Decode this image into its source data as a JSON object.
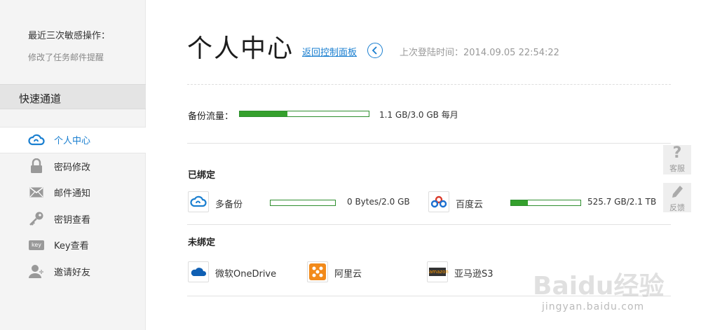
{
  "sidebar": {
    "recent_title": "最近三次敏感操作：",
    "recent_items": [
      "修改了任务邮件提醒"
    ],
    "quick_header": "快速通道",
    "nav_items": [
      {
        "label": "个人中心",
        "icon": "cloud-icon",
        "active": true
      },
      {
        "label": "密码修改",
        "icon": "lock-icon",
        "active": false
      },
      {
        "label": "邮件通知",
        "icon": "mail-icon",
        "active": false
      },
      {
        "label": "密钥查看",
        "icon": "key-icon",
        "active": false
      },
      {
        "label": "Key查看",
        "icon": "key-badge-icon",
        "badge": "key",
        "active": false
      },
      {
        "label": "邀请好友",
        "icon": "add-user-icon",
        "active": false
      }
    ]
  },
  "header": {
    "title": "个人中心",
    "back_link": "返回控制面板",
    "last_login": "上次登陆时间：2014.09.05 22:54:22"
  },
  "traffic": {
    "label": "备份流量：",
    "value": "1.1 GB/3.0 GB 每月",
    "progress": 0.37
  },
  "bound": {
    "title": "已绑定",
    "items": [
      {
        "name": "多备份",
        "value": "0 Bytes/2.0 GB",
        "progress": 0.0,
        "icon": "duobeifen-cloud-icon"
      },
      {
        "name": "百度云",
        "value": "525.7 GB/2.1 TB",
        "progress": 0.24,
        "icon": "baidu-cloud-icon"
      }
    ]
  },
  "unbound": {
    "title": "未绑定",
    "items": [
      {
        "name": "微软OneDrive",
        "icon": "onedrive-icon"
      },
      {
        "name": "阿里云",
        "icon": "aliyun-icon"
      },
      {
        "name": "亚马逊S3",
        "icon": "amazon-s3-icon",
        "badge": "amazon"
      }
    ]
  },
  "float": {
    "service_label": "客服",
    "feedback_label": "反馈"
  },
  "watermark": {
    "logo_text": "Baidu经验",
    "url_text": "jingyan.baidu.com"
  },
  "colors": {
    "accent_blue": "#1a7fd0",
    "progress_green": "#34a02c",
    "sidebar_bg": "#f4f4f4"
  }
}
